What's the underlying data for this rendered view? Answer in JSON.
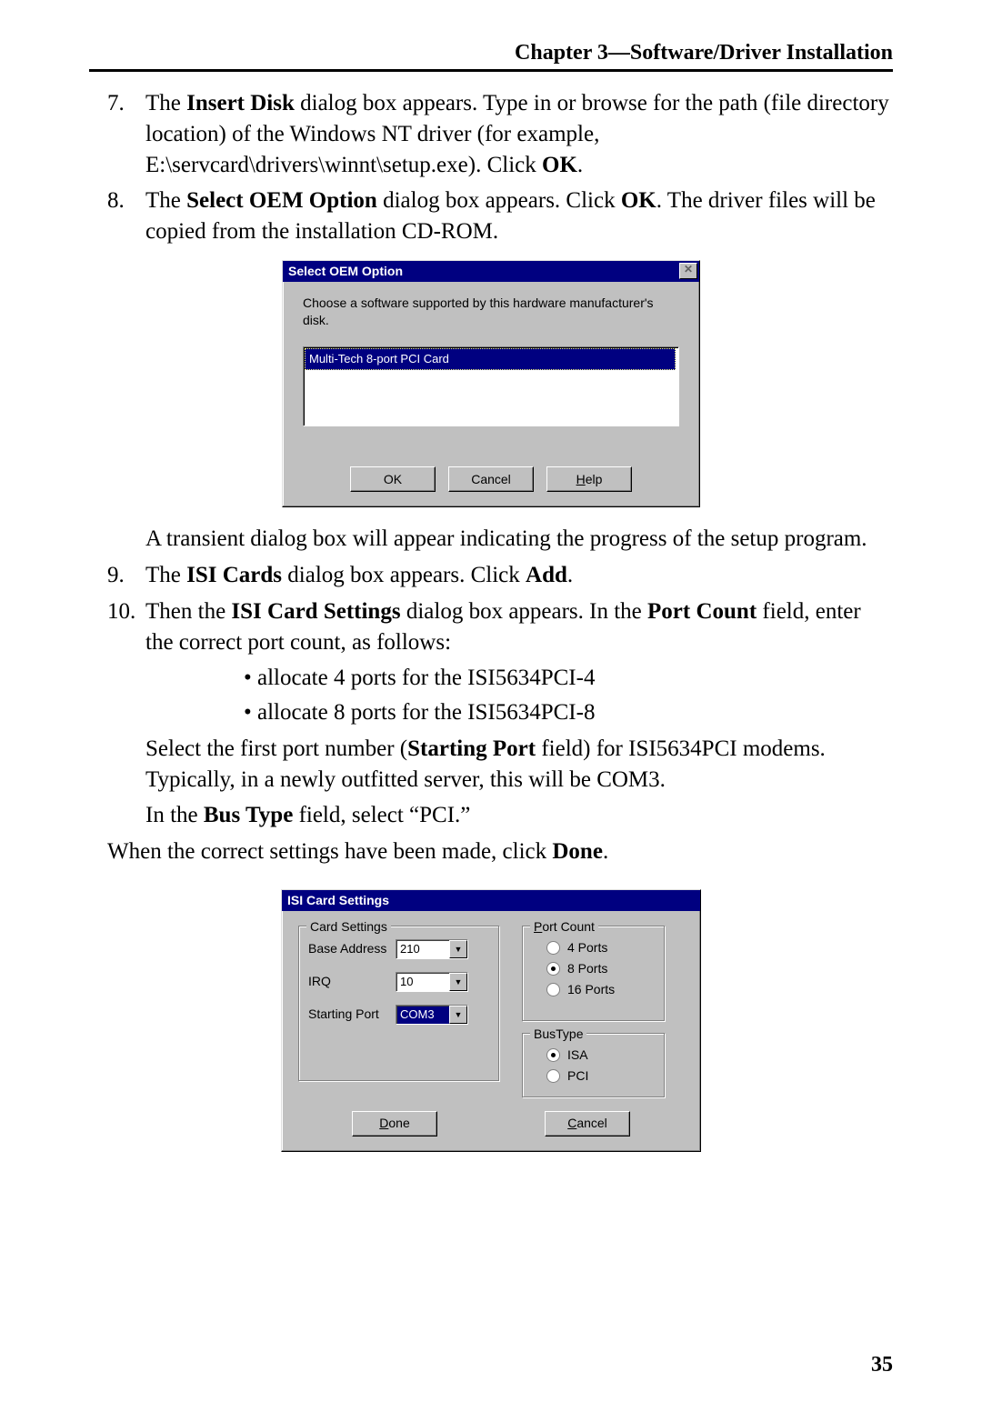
{
  "header": "Chapter 3—Software/Driver Installation",
  "steps": {
    "s7": {
      "num": "7.",
      "text_a": "The ",
      "bold_a": "Insert Disk",
      "text_b": " dialog box appears.   Type in or browse for the path (file directory location) of the Windows NT driver (for example, E:\\servcard\\drivers\\winnt\\setup.exe).  Click ",
      "bold_b": "OK",
      "text_c": "."
    },
    "s8": {
      "num": "8.",
      "text_a": "The ",
      "bold_a": "Select OEM Option",
      "text_b": " dialog box appears. Click ",
      "bold_b": "OK",
      "text_c": ". The driver files will be copied from the installation CD-ROM."
    },
    "s8_after": "A transient dialog box will appear indicating the progress of the setup program.",
    "s9": {
      "num": "9.",
      "text_a": "The ",
      "bold_a": "ISI Cards",
      "text_b": " dialog box appears. Click ",
      "bold_b": "Add",
      "text_c": "."
    },
    "s10": {
      "num": "10.",
      "text_a": "Then the ",
      "bold_a": "ISI Card Settings",
      "text_b": " dialog box appears.  In the ",
      "bold_b": "Port Count",
      "text_c": " field, enter the correct port count, as follows:",
      "bullet1": "• allocate 4 ports for the ISI5634PCI-4",
      "bullet2": "• allocate 8 ports for the ISI5634PCI-8",
      "para2_a": "Select the first port number (",
      "para2_bold": "Starting Port",
      "para2_b": " field) for ISI5634PCI modems.  Typically, in a newly outfitted server, this will be COM3.",
      "para3_a": "In the ",
      "para3_bold": "Bus Type",
      "para3_b": " field, select “PCI.”",
      "final_a": "When the correct settings have been made, click ",
      "final_bold": "Done",
      "final_b": "."
    }
  },
  "dlg1": {
    "title": "Select OEM Option",
    "close": "✕",
    "message": "Choose a software supported by this hardware manufacturer's disk.",
    "item": "Multi-Tech 8-port PCI Card",
    "ok": "OK",
    "cancel": "Cancel",
    "help_pre": "H",
    "help_rest": "elp"
  },
  "dlg2": {
    "title": "ISI Card Settings",
    "group_card": "Card Settings",
    "base_label": "Base Address",
    "base_value": "210",
    "irq_label": "IRQ",
    "irq_value": "10",
    "start_label": "Starting Port",
    "start_value": "COM3",
    "group_port_pre": "P",
    "group_port_rest": "ort Count",
    "p4": "4 Ports",
    "p8": "8 Ports",
    "p16": "16 Ports",
    "group_bus": "BusType",
    "isa": "ISA",
    "pci": "PCI",
    "done_pre": "D",
    "done_rest": "one",
    "cancel_pre": "C",
    "cancel_rest": "ancel"
  },
  "page_number": "35"
}
